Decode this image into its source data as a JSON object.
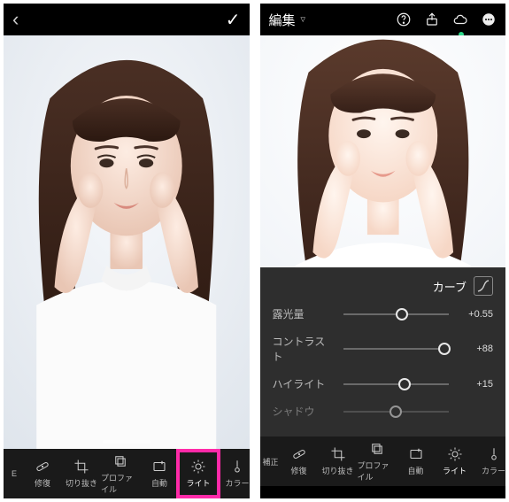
{
  "colors": {
    "accent": "#ff2aa8",
    "cloud": "#2bd88a"
  },
  "left": {
    "back": "‹",
    "confirm": "✓",
    "toolbar": [
      {
        "id": "edit-edge",
        "label": "E",
        "icon": ""
      },
      {
        "id": "heal",
        "label": "修復",
        "icon": "bandage"
      },
      {
        "id": "crop",
        "label": "切り抜き",
        "icon": "crop"
      },
      {
        "id": "profile",
        "label": "プロファイル",
        "icon": "layers"
      },
      {
        "id": "auto",
        "label": "自動",
        "icon": "wand"
      },
      {
        "id": "light",
        "label": "ライト",
        "icon": "sun",
        "active": true,
        "highlight": true
      },
      {
        "id": "color",
        "label": "カラー",
        "icon": "thermo"
      }
    ]
  },
  "right": {
    "title": "編集",
    "topIcons": [
      "help",
      "share",
      "cloud",
      "more"
    ],
    "curve": {
      "label": "カーブ"
    },
    "sliders": [
      {
        "id": "exposure",
        "label": "露光量",
        "value": "+0.55",
        "pos": 56
      },
      {
        "id": "contrast",
        "label": "コントラスト",
        "value": "+88",
        "pos": 96
      },
      {
        "id": "highlight",
        "label": "ハイライト",
        "value": "+15",
        "pos": 58
      },
      {
        "id": "shadow",
        "label": "シャドウ",
        "value": "",
        "pos": 50,
        "faded": true
      }
    ],
    "toolbar": [
      {
        "id": "correct-edge",
        "label": "補正",
        "icon": ""
      },
      {
        "id": "heal",
        "label": "修復",
        "icon": "bandage"
      },
      {
        "id": "crop",
        "label": "切り抜き",
        "icon": "crop"
      },
      {
        "id": "profile",
        "label": "プロファイル",
        "icon": "layers"
      },
      {
        "id": "auto",
        "label": "自動",
        "icon": "wand"
      },
      {
        "id": "light",
        "label": "ライト",
        "icon": "sun",
        "active": true
      },
      {
        "id": "color",
        "label": "カラー",
        "icon": "thermo"
      }
    ]
  }
}
